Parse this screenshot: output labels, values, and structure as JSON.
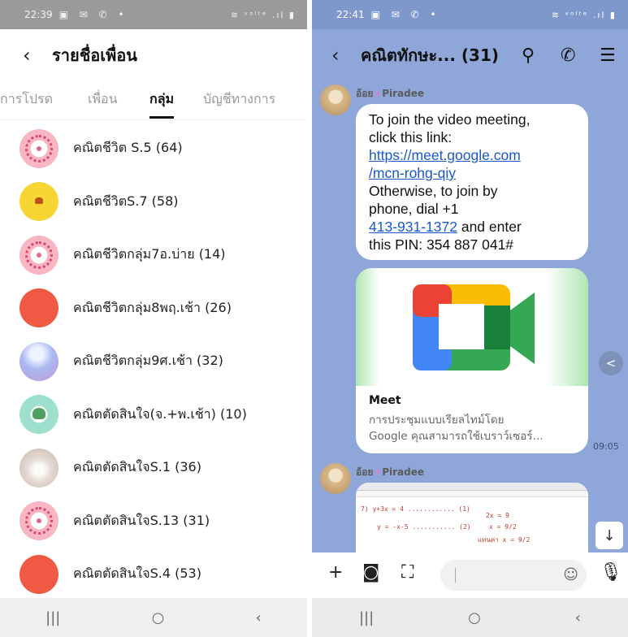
{
  "left": {
    "status": {
      "time": "22:39",
      "indicators": "▣ ✉ ✆ •",
      "right": "≋ ᵛᵒˡᵗᵉ .ıl ▮"
    },
    "header": {
      "back": "‹",
      "title": "รายชื่อเพื่อน"
    },
    "tabs": [
      "การโปรด",
      "เพื่อน",
      "กลุ่ม",
      "บัญชีทางการ"
    ],
    "active_tab": "กลุ่ม",
    "groups": [
      {
        "name": "คณิตชีวิต S.5 (64)",
        "avatar": "wreath-avatar"
      },
      {
        "name": "คณิตชีวิตS.7 (58)",
        "avatar": "yellow-character-avatar"
      },
      {
        "name": "คณิตชีวิตกลุ่ม7อ.บ่าย (14)",
        "avatar": "wreath-avatar"
      },
      {
        "name": "คณิตชีวิตกลุ่ม8พฤ.เช้า (26)",
        "avatar": "red-circle-avatar"
      },
      {
        "name": "คณิตชีวิตกลุ่ม9ศ.เช้า (32)",
        "avatar": "gradient-avatar"
      },
      {
        "name": "คณิตตัดสินใจ(จ.+พ.เช้า) (10)",
        "avatar": "leaves-avatar"
      },
      {
        "name": "คณิตตัดสินใจS.1 (36)",
        "avatar": "flower-avatar"
      },
      {
        "name": "คณิตตัดสินใจS.13 (31)",
        "avatar": "wreath-avatar"
      },
      {
        "name": "คณิตตัดสินใจS.4 (53)",
        "avatar": "red-circle-avatar"
      }
    ],
    "nav": [
      "|||",
      "○",
      "‹"
    ]
  },
  "right": {
    "status": {
      "time": "22:41",
      "indicators": "▣ ✉ ✆ •",
      "right": "≋ ᵛᵒˡᵗᵉ .ıl ▮"
    },
    "header": {
      "back": "‹",
      "title": "คณิตทักษะ... (31)",
      "search": "⚲",
      "call": "✆",
      "menu": "☰"
    },
    "messages": {
      "sender": "อ้อย",
      "sender_suffix": "Piradee",
      "sender_star": "★",
      "text_line1": "To join the video meeting,",
      "text_line2": "click this link:",
      "link_line1": "https://meet.google.com",
      "link_line2": "/mcn-rohg-qiy",
      "text_line3": "Otherwise, to join by",
      "text_line4": "phone, dial +1",
      "phone_link": "413-931-1372",
      "text_line5": " and enter",
      "text_line6": "this PIN: 354 887 041#",
      "card_title": "Meet",
      "card_desc1": "การประชุมแบบเรียลไทม์โดย",
      "card_desc2": "Google คุณสามารถใช้เบราว์เซอร์...",
      "time": "09:05",
      "share": "<",
      "scroll_down": "↓",
      "math1": "7) y+3x = 4 ............ (1)",
      "math2": "y = -x-5 ........... (2)",
      "math3": "2x = 9",
      "math4": "x = 9/2",
      "math5": "แทนค่า x = 9/2"
    },
    "composer": {
      "plus": "+",
      "camera": "◙",
      "image": "⛶",
      "emoji": "☺",
      "mic": "🎙"
    },
    "nav": [
      "|||",
      "○",
      "‹"
    ],
    "colors": {
      "chat_bg": "#8fa7d8",
      "link": "#1a58c8"
    }
  }
}
